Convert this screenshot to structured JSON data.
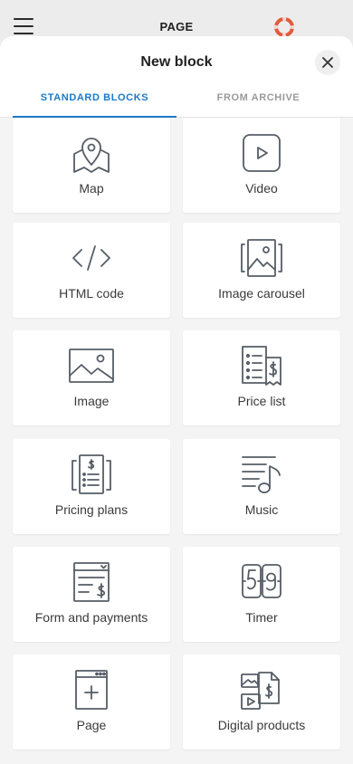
{
  "app": {
    "title": "PAGE",
    "menu_icon": "hamburger-icon",
    "help_icon": "lifebuoy-icon",
    "help_color": "#e25a3c"
  },
  "sheet": {
    "title": "New block",
    "close_icon": "close-icon",
    "tabs": [
      {
        "label": "STANDARD BLOCKS",
        "active": true
      },
      {
        "label": "FROM ARCHIVE",
        "active": false
      }
    ],
    "accent": "#1a7ac9",
    "blocks": [
      {
        "label": "Map",
        "icon": "map-icon"
      },
      {
        "label": "Video",
        "icon": "video-icon"
      },
      {
        "label": "HTML code",
        "icon": "code-icon"
      },
      {
        "label": "Image carousel",
        "icon": "image-carousel-icon"
      },
      {
        "label": "Image",
        "icon": "image-icon"
      },
      {
        "label": "Price list",
        "icon": "price-list-icon"
      },
      {
        "label": "Pricing plans",
        "icon": "pricing-plans-icon"
      },
      {
        "label": "Music",
        "icon": "music-icon"
      },
      {
        "label": "Form and payments",
        "icon": "form-payments-icon"
      },
      {
        "label": "Timer",
        "icon": "timer-icon"
      },
      {
        "label": "Page",
        "icon": "page-icon"
      },
      {
        "label": "Digital products",
        "icon": "digital-products-icon"
      }
    ]
  }
}
